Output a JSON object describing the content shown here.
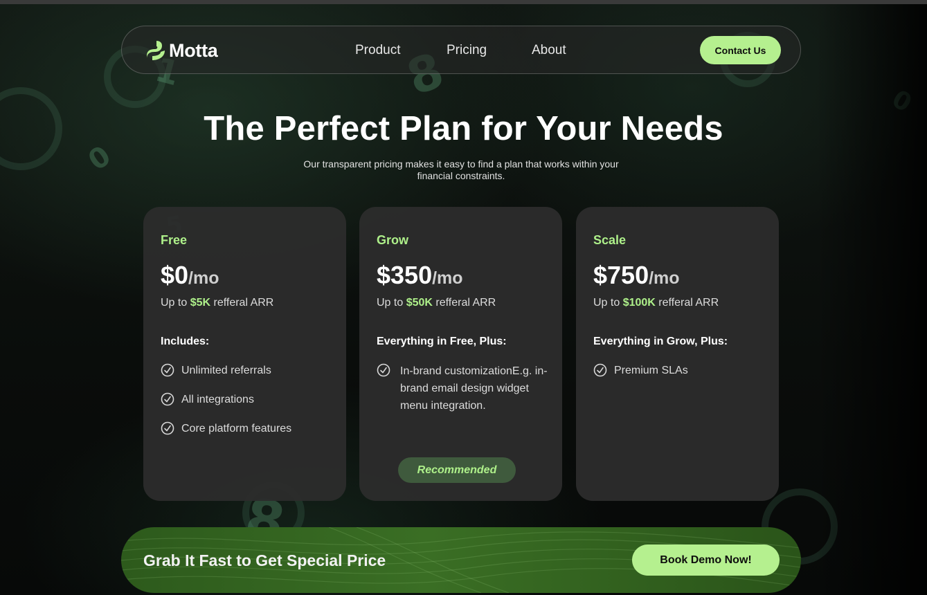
{
  "brand": {
    "name": "Motta",
    "accent": "#b5f08f",
    "accent_text": "#aef08a"
  },
  "nav": {
    "links": [
      "Product",
      "Pricing",
      "About"
    ],
    "contact_label": "Contact Us"
  },
  "hero": {
    "title": "The Perfect Plan for Your Needs",
    "subtitle": "Our transparent pricing makes it easy to find a plan that works within your financial constraints."
  },
  "plans": [
    {
      "name": "Free",
      "price": "$0",
      "period": "/mo",
      "arr_prefix": "Up to ",
      "arr_amount": "$5K",
      "arr_suffix": " refferal ARR",
      "includes_title": "Includes:",
      "features": [
        "Unlimited referrals",
        "All integrations",
        "Core platform features"
      ]
    },
    {
      "name": "Grow",
      "price": "$350",
      "period": "/mo",
      "arr_prefix": "Up to ",
      "arr_amount": "$50K",
      "arr_suffix": " refferal ARR",
      "includes_title": "Everything in Free, Plus:",
      "features": [
        "In-brand customizationE.g. in-brand email design widget menu integration."
      ],
      "badge": "Recommended"
    },
    {
      "name": "Scale",
      "price": "$750",
      "period": "/mo",
      "arr_prefix": "Up to ",
      "arr_amount": "$100K",
      "arr_suffix": " refferal ARR",
      "includes_title": "Everything in Grow, Plus:",
      "features": [
        "Premium SLAs"
      ]
    }
  ],
  "cta": {
    "text": "Grab It Fast to Get Special Price",
    "button_label": "Book Demo Now!"
  },
  "icons": {
    "logo": "motta-logo-icon",
    "feature_check": "check-circle-icon"
  }
}
